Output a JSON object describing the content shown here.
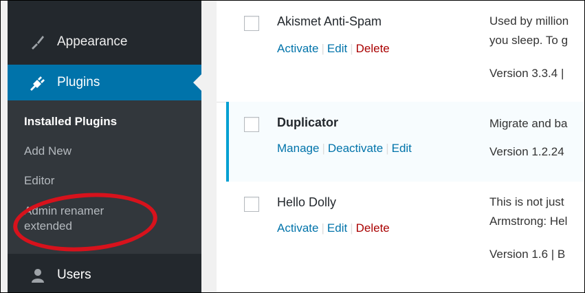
{
  "sidebar": {
    "appearance": {
      "label": "Appearance",
      "icon": "brush-icon"
    },
    "plugins": {
      "label": "Plugins",
      "icon": "plug-icon"
    },
    "users": {
      "label": "Users",
      "icon": "user-icon"
    },
    "submenu": [
      "Installed Plugins",
      "Add New",
      "Editor",
      "Admin renamer",
      "extended"
    ]
  },
  "plugins": [
    {
      "name": "Akismet Anti-Spam",
      "actions": {
        "a": "Activate",
        "b": "Edit",
        "c": "Delete"
      },
      "desc": [
        "Used by million",
        "you sleep. To g"
      ],
      "version": "Version 3.3.4 |"
    },
    {
      "name": "Duplicator",
      "actions": {
        "a": "Manage",
        "b": "Deactivate",
        "c": "Edit"
      },
      "desc": [
        "Migrate and ba"
      ],
      "version": "Version 1.2.24"
    },
    {
      "name": "Hello Dolly",
      "actions": {
        "a": "Activate",
        "b": "Edit",
        "c": "Delete"
      },
      "desc": [
        "This is not just",
        "Armstrong: Hel"
      ],
      "version": "Version 1.6 | B"
    }
  ],
  "colors": {
    "sidebar": "#23282d",
    "accent": "#0073aa",
    "highlight": "#d7121c",
    "delete": "#a00"
  }
}
